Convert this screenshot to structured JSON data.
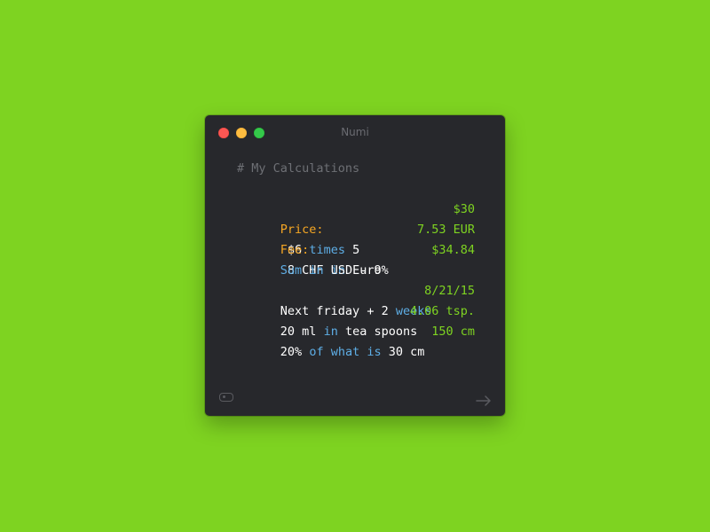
{
  "app": {
    "title": "Numi"
  },
  "colors": {
    "background": "#7ed321",
    "window": "#27282c",
    "label": "#f5a623",
    "keyword": "#5eaee6",
    "result": "#7ed321",
    "comment": "#6e7075"
  },
  "editor": {
    "comment": "# My Calculations",
    "lines": [
      {
        "label": "Price:",
        "tokens": [
          "$6",
          "times",
          "5"
        ],
        "result": "$30"
      },
      {
        "label": "Fee:",
        "tokens": [
          "8 CHF",
          "in",
          "Euro"
        ],
        "result": "7.53 EUR"
      },
      {
        "label": "",
        "tokens": [
          "Sum",
          "in",
          "USD - 9%"
        ],
        "result": "$34.84"
      },
      {
        "label": "",
        "tokens": [
          "Next friday + 2",
          "weeks"
        ],
        "result": "8/21/15"
      },
      {
        "label": "",
        "tokens": [
          "20 ml",
          "in",
          "tea spoons"
        ],
        "result": "4.06 tsp."
      },
      {
        "label": "",
        "tokens": [
          "20%",
          "of what is",
          "30 cm"
        ],
        "result": "150 cm"
      }
    ]
  },
  "footer": {
    "left_icon": "toggle-icon",
    "right_icon": "arrow-right-icon"
  }
}
